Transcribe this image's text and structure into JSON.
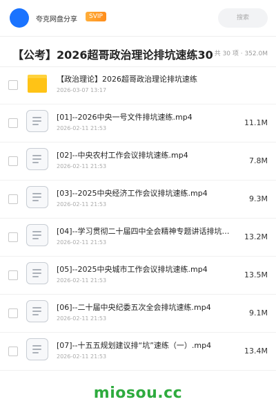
{
  "header": {
    "user_name": "夸克网盘分享",
    "vip_badge": "SVIP",
    "search_placeholder": "搜索"
  },
  "share": {
    "title": "【公考】2026超哥政治理论排坑速练30",
    "stats": "共 30 项 · 352.0M"
  },
  "files": [
    {
      "type": "folder",
      "name": "【政治理论】2026超哥政治理论排坑速练",
      "date": "2026-03-07 13:17",
      "size": ""
    },
    {
      "type": "video",
      "name": "[01]--2026中央一号文件排坑速练.mp4",
      "date": "2026-02-11 21:53",
      "size": "11.1M"
    },
    {
      "type": "video",
      "name": "[02]--中央农村工作会议排坑速练.mp4",
      "date": "2026-02-11 21:53",
      "size": "7.8M"
    },
    {
      "type": "video",
      "name": "[03]--2025中央经济工作会议排坑速练.mp4",
      "date": "2026-02-11 21:53",
      "size": "9.3M"
    },
    {
      "type": "video",
      "name": "[04]--学习贯彻二十届四中全会精神专题讲话排坑…",
      "date": "2026-02-11 21:53",
      "size": "13.2M"
    },
    {
      "type": "video",
      "name": "[05]--2025中央城市工作会议排坑速练.mp4",
      "date": "2026-02-11 21:53",
      "size": "13.5M"
    },
    {
      "type": "video",
      "name": "[06]--二十届中央纪委五次全会排坑速练.mp4",
      "date": "2026-02-11 21:53",
      "size": "9.1M"
    },
    {
      "type": "video",
      "name": "[07]--十五五规划建议排“坑”速练（一）.mp4",
      "date": "2026-02-11 21:53",
      "size": "13.4M"
    }
  ],
  "watermark": "miosou.cc",
  "colors": {
    "accent": "#1a73ff",
    "vip": "#ff8c1a",
    "folder": "#ffc316",
    "watermark": "#2eab3e"
  }
}
